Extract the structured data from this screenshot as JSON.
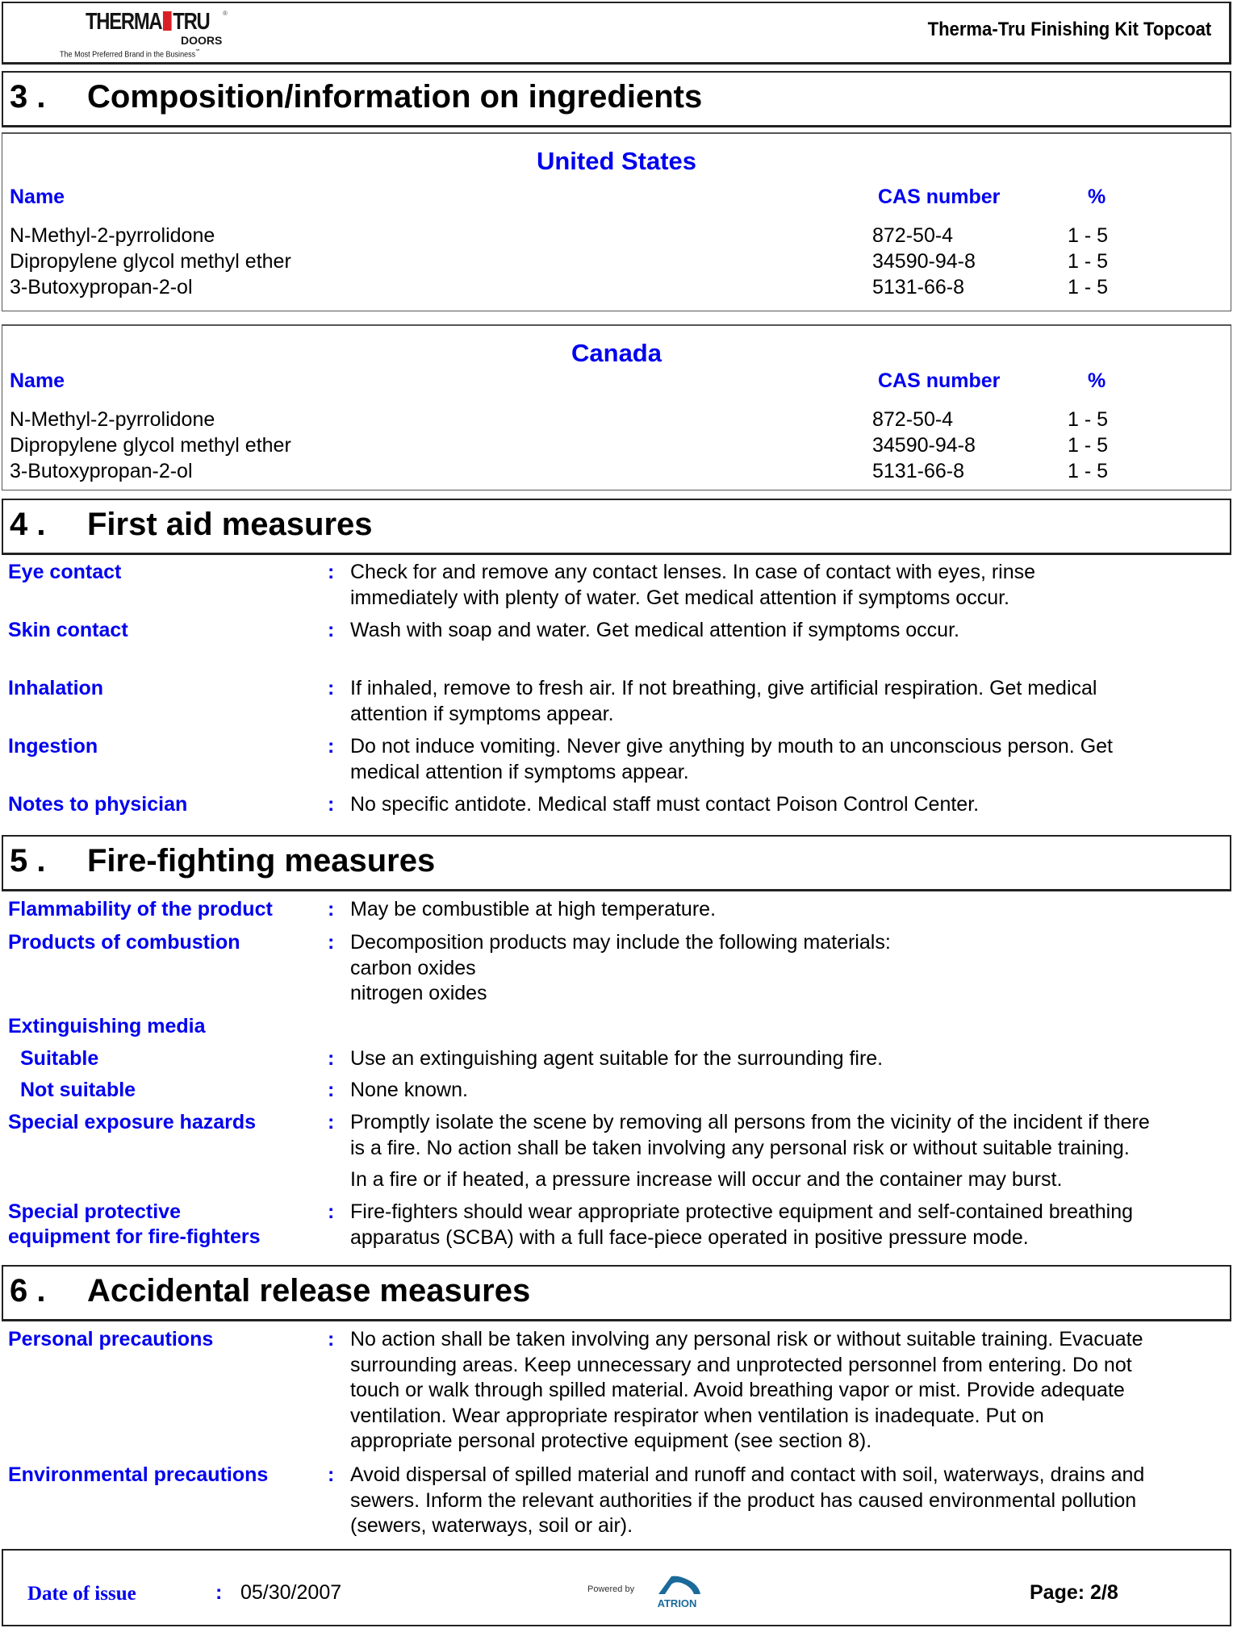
{
  "header": {
    "logo": {
      "brand_left": "THERMA",
      "brand_right": "TRU",
      "registered": "®",
      "sub": "DOORS",
      "tagline": "The Most Preferred Brand in the Business",
      "tagline_mark": "℠",
      "icon": "door-icon",
      "accent_color": "#d91f26"
    },
    "document_title": "Therma-Tru Finishing Kit Topcoat"
  },
  "colors": {
    "label_blue": "#0000ee",
    "text": "#000000",
    "border": "#222222"
  },
  "sections": [
    {
      "number": "3 .",
      "title": "Composition/information on ingredients",
      "tables": [
        {
          "region": "United States",
          "columns": [
            "Name",
            "CAS number",
            "%"
          ],
          "rows": [
            [
              "N-Methyl-2-pyrrolidone",
              "872-50-4",
              "1 - 5"
            ],
            [
              "Dipropylene glycol methyl ether",
              "34590-94-8",
              "1 - 5"
            ],
            [
              "3-Butoxypropan-2-ol",
              "5131-66-8",
              "1 - 5"
            ]
          ]
        },
        {
          "region": "Canada",
          "columns": [
            "Name",
            "CAS number",
            "%"
          ],
          "rows": [
            [
              "N-Methyl-2-pyrrolidone",
              "872-50-4",
              "1 - 5"
            ],
            [
              "Dipropylene glycol methyl ether",
              "34590-94-8",
              "1 - 5"
            ],
            [
              "3-Butoxypropan-2-ol",
              "5131-66-8",
              "1 - 5"
            ]
          ]
        }
      ]
    },
    {
      "number": "4 .",
      "title": "First aid measures",
      "items": [
        {
          "label": "Eye contact",
          "lines": [
            "Check for and remove any contact lenses.  In case of contact with eyes, rinse",
            "immediately with plenty of water.  Get medical attention if symptoms occur."
          ]
        },
        {
          "label": "Skin contact",
          "lines": [
            "Wash with soap and water.  Get medical attention if symptoms occur."
          ]
        },
        {
          "label": "Inhalation",
          "lines": [
            "If inhaled, remove to fresh air.  If not breathing, give artificial respiration.  Get medical",
            "attention if symptoms appear."
          ]
        },
        {
          "label": "Ingestion",
          "lines": [
            "Do not induce vomiting.  Never give anything by mouth to an unconscious person.  Get",
            "medical attention if symptoms appear."
          ]
        },
        {
          "label": "Notes to physician",
          "lines": [
            "No specific antidote. Medical staff must contact Poison Control Center."
          ]
        }
      ]
    },
    {
      "number": "5 .",
      "title": "Fire-fighting measures",
      "items": [
        {
          "label": "Flammability of the product",
          "lines": [
            "May be combustible at high temperature."
          ]
        },
        {
          "label": "Products of combustion",
          "lines": [
            "Decomposition products may include the following materials:",
            "carbon oxides",
            "nitrogen oxides"
          ]
        },
        {
          "label": "Extinguishing media",
          "lines": []
        },
        {
          "label": "Suitable",
          "lines": [
            "Use an extinguishing agent suitable for the surrounding fire."
          ]
        },
        {
          "label": "Not suitable",
          "lines": [
            "None known."
          ]
        },
        {
          "label": "Special exposure hazards",
          "lines": [
            "Promptly isolate the scene by removing all persons from the vicinity of the incident if there",
            "is a fire.  No action shall be taken involving any personal risk or without suitable training."
          ],
          "extra_line": "In a fire or if heated, a pressure increase will occur and the container may burst."
        },
        {
          "label_lines": [
            "Special protective",
            "equipment for fire-fighters"
          ],
          "lines": [
            "Fire-fighters should wear appropriate protective equipment and self-contained breathing",
            "apparatus (SCBA) with a full face-piece operated in positive pressure mode."
          ]
        }
      ]
    },
    {
      "number": "6 .",
      "title": "Accidental release measures",
      "items": [
        {
          "label": "Personal precautions",
          "lines": [
            "No action shall be taken involving any personal risk or without suitable training.  Evacuate",
            "surrounding areas.  Keep unnecessary and unprotected personnel from entering.  Do not",
            "touch or walk through spilled material.  Avoid breathing vapor or mist.  Provide adequate",
            "ventilation.  Wear appropriate respirator when ventilation is inadequate.  Put on",
            "appropriate personal protective equipment (see section 8)."
          ]
        },
        {
          "label": "Environmental precautions",
          "lines": [
            "Avoid dispersal of spilled material and runoff and contact with soil, waterways, drains and",
            "sewers.  Inform the relevant authorities if the product has caused environmental pollution",
            "(sewers, waterways, soil or air)."
          ]
        }
      ]
    }
  ],
  "separator": ":",
  "footer": {
    "date_label": "Date of issue",
    "date_value": "05/30/2007",
    "powered_by": "Powered by",
    "powered_logo": "ATRION",
    "powered_icon": "atrion-logo-icon",
    "page_label": "Page: 2/8"
  }
}
